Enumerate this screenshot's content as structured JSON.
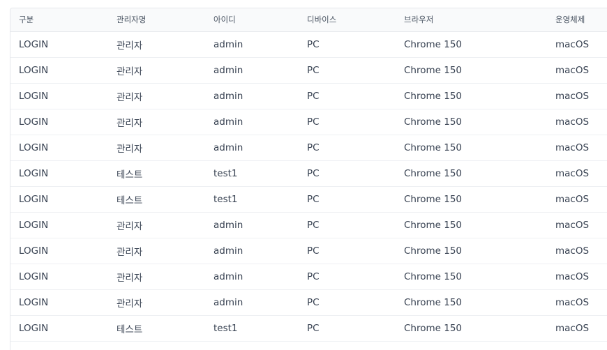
{
  "table": {
    "columns": [
      "구분",
      "관리자명",
      "아이디",
      "디바이스",
      "브라우저",
      "운영체제"
    ],
    "rows": [
      [
        "LOGIN",
        "관리자",
        "admin",
        "PC",
        "Chrome 150",
        "macOS"
      ],
      [
        "LOGIN",
        "관리자",
        "admin",
        "PC",
        "Chrome 150",
        "macOS"
      ],
      [
        "LOGIN",
        "관리자",
        "admin",
        "PC",
        "Chrome 150",
        "macOS"
      ],
      [
        "LOGIN",
        "관리자",
        "admin",
        "PC",
        "Chrome 150",
        "macOS"
      ],
      [
        "LOGIN",
        "관리자",
        "admin",
        "PC",
        "Chrome 150",
        "macOS"
      ],
      [
        "LOGIN",
        "테스트",
        "test1",
        "PC",
        "Chrome 150",
        "macOS"
      ],
      [
        "LOGIN",
        "테스트",
        "test1",
        "PC",
        "Chrome 150",
        "macOS"
      ],
      [
        "LOGIN",
        "관리자",
        "admin",
        "PC",
        "Chrome 150",
        "macOS"
      ],
      [
        "LOGIN",
        "관리자",
        "admin",
        "PC",
        "Chrome 150",
        "macOS"
      ],
      [
        "LOGIN",
        "관리자",
        "admin",
        "PC",
        "Chrome 150",
        "macOS"
      ],
      [
        "LOGIN",
        "관리자",
        "admin",
        "PC",
        "Chrome 150",
        "macOS"
      ],
      [
        "LOGIN",
        "테스트",
        "test1",
        "PC",
        "Chrome 150",
        "macOS"
      ]
    ]
  }
}
